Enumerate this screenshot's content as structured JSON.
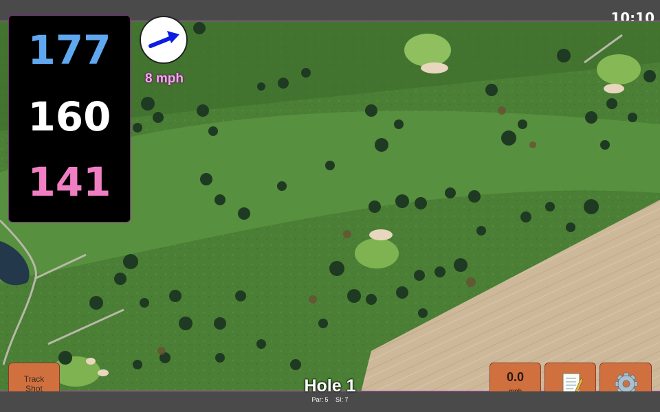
{
  "status": {
    "time": "10:10"
  },
  "distances": {
    "back": "177",
    "middle": "160",
    "front": "141"
  },
  "wind": {
    "speed_label": "8 mph",
    "direction_icon": "wind-direction-arrow-icon"
  },
  "buttons": {
    "track_shot": "Track\nShot",
    "speed_value": "0.0",
    "speed_unit": "mph",
    "notes_icon": "notepad-icon",
    "settings_icon": "gear-icon"
  },
  "hole": {
    "title": "Hole 1",
    "par_label": "Par: 5",
    "si_label": "SI: 7"
  },
  "colors": {
    "back_distance": "#5fa8f0",
    "middle_distance": "#ffffff",
    "front_distance": "#f07ec2",
    "button_bg": "#d0703f",
    "fairway": "#4f8a3a",
    "rough": "#3f6f2d",
    "field": "#cdb99a"
  }
}
